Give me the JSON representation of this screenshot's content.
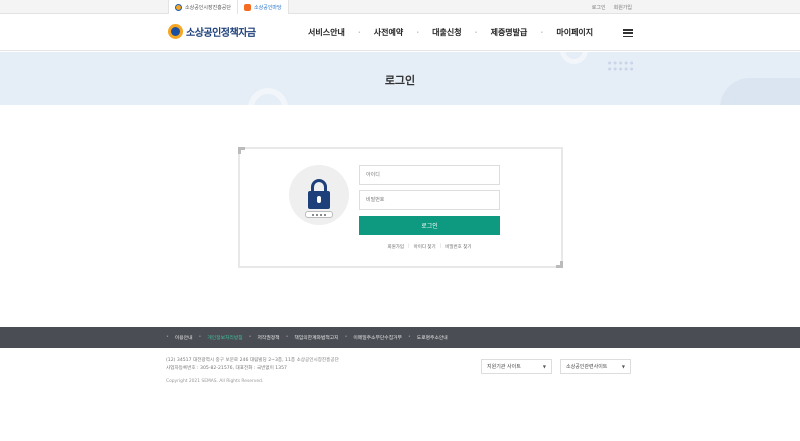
{
  "topbar": {
    "family_sites": [
      "소상공인시장진흥공단",
      "소상공인마당"
    ],
    "util_links": [
      "로그인",
      "회원가입"
    ]
  },
  "header": {
    "logo_text": "소상공인정책자금",
    "nav": [
      "서비스안내",
      "사전예약",
      "대출신청",
      "제증명발급",
      "마이페이지"
    ]
  },
  "banner": {
    "title": "로그인"
  },
  "login": {
    "id_placeholder": "아이디",
    "pw_placeholder": "비밀번호",
    "submit_label": "로그인",
    "links": [
      "회원가입",
      "아이디 찾기",
      "비밀번호 찾기"
    ]
  },
  "footer": {
    "menu": [
      "이용안내",
      "개인정보처리방침",
      "저작권정책",
      "책임의한계와법적고지",
      "이메일주소무단수집거부",
      "도로명주소안내"
    ],
    "address_line1": "(12) 34517 대전광역시 중구 보문로 246 대림빌딩 2~3층, 11층 소상공인시장진흥공단",
    "address_line2": "사업자등록번호 : 305-82-21576, 대표전화 : 국번없이 1357",
    "copyright": "Copyright 2021 SEMAS. All Rights Reserved.",
    "select1": "지원기관 사이트",
    "select2": "소상공인관련사이트"
  },
  "colors": {
    "accent": "#0e9a80",
    "brand": "#1d3f7a",
    "banner": "#e5edf7",
    "footer_bar": "#4a4d54"
  }
}
